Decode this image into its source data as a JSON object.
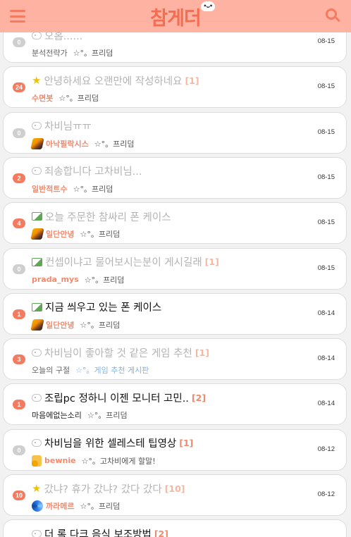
{
  "header": {
    "logo": "참게더",
    "logo_badge": "•ᴗ•"
  },
  "posts": [
    {
      "badge": "0",
      "icon": "bubble-icon",
      "title": "오홉......",
      "comments": "",
      "level_icon": "",
      "author": "분석전략가",
      "author_style": "plain",
      "board": "☆°。프리덤",
      "board_style": "normal",
      "date": "08-15",
      "read": true
    },
    {
      "badge": "24",
      "icon": "star-icon",
      "title": "안녕하세요 오랜만에 작성하네요",
      "comments": "[1]",
      "level_icon": "",
      "author": "수면봇",
      "author_style": "accent",
      "board": "☆°。프리덤",
      "board_style": "normal",
      "date": "08-15",
      "read": true
    },
    {
      "badge": "0",
      "icon": "bubble-icon",
      "title": "차비님ㅠㅠ",
      "comments": "",
      "level_icon": "feather",
      "author": "아낙필락시스",
      "author_style": "accent",
      "board": "☆°。프리덤",
      "board_style": "normal",
      "date": "08-15",
      "read": true
    },
    {
      "badge": "2",
      "icon": "bubble-icon",
      "title": "죄송합니다 고차비님...",
      "comments": "",
      "level_icon": "",
      "author": "일반적트수",
      "author_style": "accent",
      "board": "☆°。프리덤",
      "board_style": "normal",
      "date": "08-15",
      "read": true
    },
    {
      "badge": "4",
      "icon": "image-icon",
      "title": "오늘 주문한 참싸리 폰 케이스",
      "comments": "",
      "level_icon": "feather",
      "author": "일단안녕",
      "author_style": "accent",
      "board": "☆°。프리덤",
      "board_style": "normal",
      "date": "08-15",
      "read": true
    },
    {
      "badge": "0",
      "icon": "image-icon",
      "title": "컨셉이냐고 물어보시는분이 게시길래",
      "comments": "[1]",
      "level_icon": "",
      "author": "prada_mys",
      "author_style": "accent",
      "board": "☆°。프리덤",
      "board_style": "normal",
      "date": "08-15",
      "read": true
    },
    {
      "badge": "1",
      "icon": "image-icon",
      "title": "지금 씌우고 있는 폰 케이스",
      "comments": "",
      "level_icon": "feather",
      "author": "일단안녕",
      "author_style": "accent",
      "board": "☆°。프리덤",
      "board_style": "normal",
      "date": "08-14",
      "read": false
    },
    {
      "badge": "3",
      "icon": "bubble-icon",
      "title": "차비님이 좋아할 것 같은 게임 추천",
      "comments": "[1]",
      "level_icon": "",
      "author": "오늘의 구절",
      "author_style": "plain",
      "board": "☆°。게임 추천 게시판",
      "board_style": "blue",
      "date": "08-14",
      "read": true
    },
    {
      "badge": "1",
      "icon": "bubble-icon",
      "title": "조립pc 정하니 이젠 모니터 고민..",
      "comments": "[2]",
      "level_icon": "",
      "author": "마음에없는소리",
      "author_style": "dark",
      "board": "☆°。프리덤",
      "board_style": "normal",
      "date": "08-14",
      "read": false
    },
    {
      "badge": "0",
      "icon": "bubble-icon",
      "title": "차비님을 위한 셀레스테 팁영상",
      "comments": "[1]",
      "level_icon": "note",
      "author": "bewnie",
      "author_style": "accent",
      "board": "☆°。고차비에게 할말!",
      "board_style": "normal",
      "date": "08-12",
      "read": false
    },
    {
      "badge": "10",
      "icon": "star-icon",
      "title": "갔냐? 휴가 갔냐? 갔다 갔다",
      "comments": "[10]",
      "level_icon": "swirl",
      "author": "까라메르",
      "author_style": "accent",
      "board": "☆°。프리덤",
      "board_style": "normal",
      "date": "08-12",
      "read": true
    },
    {
      "badge": "",
      "icon": "bubble-icon",
      "title": "더 록 다크 음식 보조방법",
      "comments": "[2]",
      "level_icon": "",
      "author": "",
      "author_style": "accent",
      "board": "",
      "board_style": "normal",
      "date": "",
      "read": false
    }
  ]
}
